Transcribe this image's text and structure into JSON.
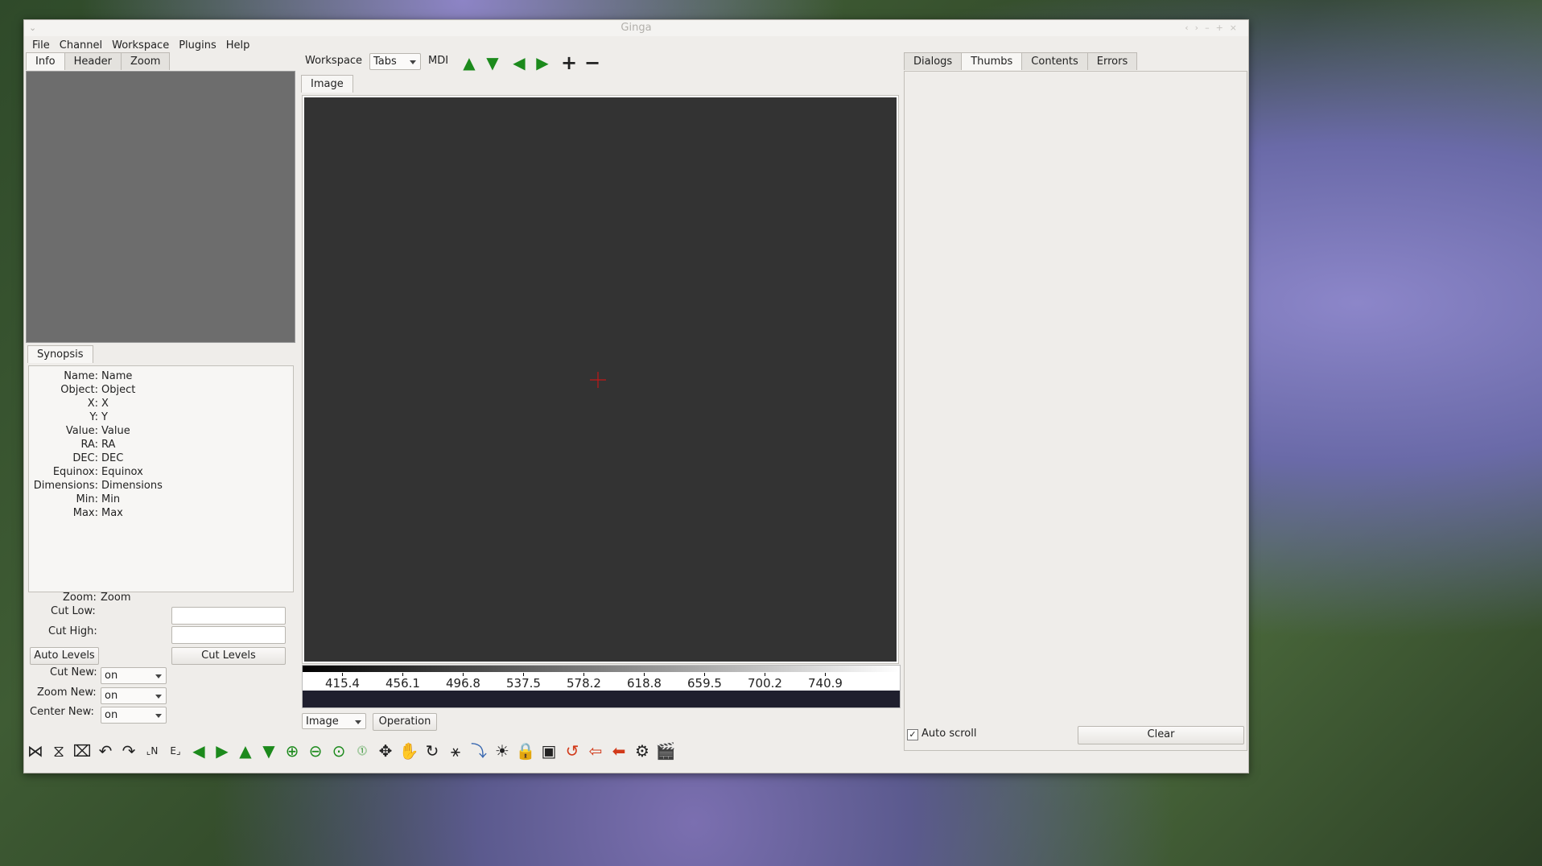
{
  "window": {
    "title": "Ginga"
  },
  "menu": [
    "File",
    "Channel",
    "Workspace",
    "Plugins",
    "Help"
  ],
  "left_tabs": [
    "Info",
    "Header",
    "Zoom"
  ],
  "left_active_tab": "Info",
  "synopsis_tab": "Synopsis",
  "synopsis": [
    {
      "key": "Name:",
      "value": "Name"
    },
    {
      "key": "Object:",
      "value": "Object"
    },
    {
      "key": "X:",
      "value": "X"
    },
    {
      "key": "Y:",
      "value": "Y"
    },
    {
      "key": "Value:",
      "value": "Value"
    },
    {
      "key": "RA:",
      "value": "RA"
    },
    {
      "key": "DEC:",
      "value": "DEC"
    },
    {
      "key": "Equinox:",
      "value": "Equinox"
    },
    {
      "key": "Dimensions:",
      "value": "Dimensions"
    },
    {
      "key": "Min:",
      "value": "Min"
    },
    {
      "key": "Max:",
      "value": "Max"
    }
  ],
  "controls": {
    "zoom_label": "Zoom:",
    "zoom_value": "Zoom",
    "cut_low_label": "Cut Low:",
    "cut_low_value": "",
    "cut_high_label": "Cut High:",
    "cut_high_value": "",
    "auto_levels": "Auto Levels",
    "cut_levels": "Cut Levels",
    "cut_new_label": "Cut New:",
    "cut_new_value": "on",
    "zoom_new_label": "Zoom New:",
    "zoom_new_value": "on",
    "center_new_label": "Center New:",
    "center_new_value": "on"
  },
  "workspace": {
    "label": "Workspace",
    "mode": "Tabs",
    "mdi": "MDI",
    "tab": "Image",
    "toolbar_icons": [
      "arrow-up-icon",
      "arrow-down-icon",
      "arrow-left-icon",
      "arrow-right-icon",
      "plus-icon",
      "minus-icon"
    ]
  },
  "colorbar": {
    "ticks": [
      "415.4",
      "456.1",
      "496.8",
      "537.5",
      "578.2",
      "618.8",
      "659.5",
      "700.2",
      "740.9"
    ]
  },
  "bottom": {
    "channel": "Image",
    "operation": "Operation"
  },
  "bottom_toolbar_icons": [
    "flip-x-icon",
    "flip-y-icon",
    "swap-xy-icon",
    "rotate-ccw-icon",
    "rotate-cw-icon",
    "orient-ne-icon",
    "orient-ne-flip-icon",
    "prev-image-icon",
    "next-image-icon",
    "prev-channel-icon",
    "next-channel-icon",
    "zoom-in-icon",
    "zoom-out-icon",
    "zoom-fit-icon",
    "zoom-100-icon",
    "pan-icon",
    "hand-icon",
    "rotate-icon",
    "contrast-icon",
    "cuts-icon",
    "brightness-icon",
    "lock-icon",
    "colormap-icon",
    "reset-rotation-icon",
    "reset-contrast-icon",
    "reset-colormap-icon",
    "settings-icon",
    "clapper-icon"
  ],
  "right_tabs": [
    "Dialogs",
    "Thumbs",
    "Contents",
    "Errors"
  ],
  "right_active_tab": "Thumbs",
  "right_bottom": {
    "auto_scroll": "Auto scroll",
    "auto_scroll_checked": true,
    "clear": "Clear"
  }
}
